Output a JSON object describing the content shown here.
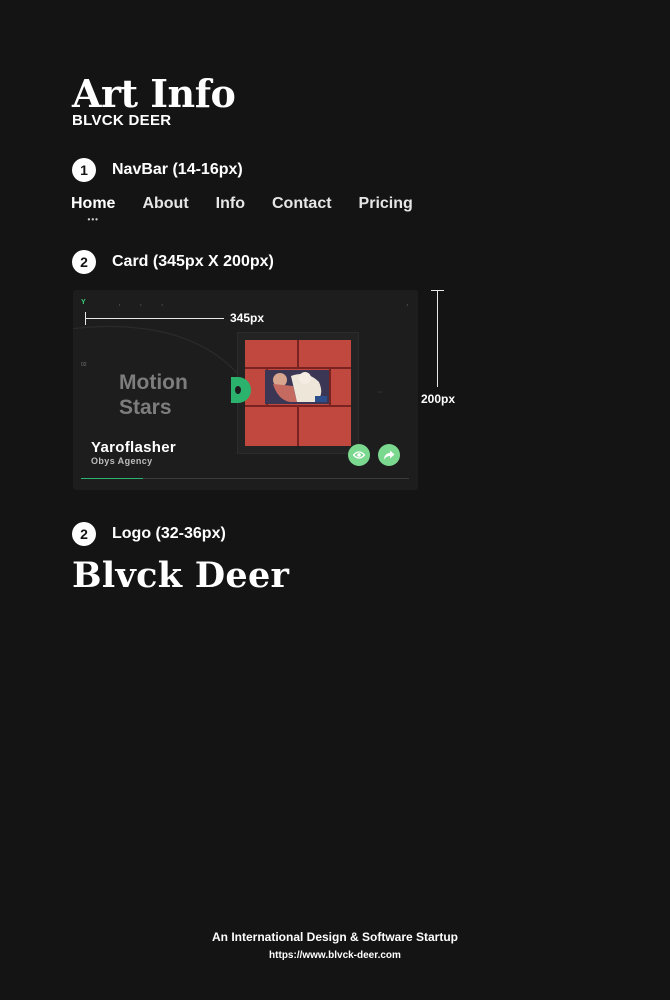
{
  "header": {
    "title": "Art Info",
    "subtitle": "BLVCK DEER"
  },
  "sections": [
    {
      "number": "1",
      "label": "NavBar (14-16px)"
    },
    {
      "number": "2",
      "label": "Card (345px X 200px)"
    },
    {
      "number": "2",
      "label": "Logo (32-36px)"
    }
  ],
  "nav": {
    "items": [
      {
        "label": "Home",
        "active": true
      },
      {
        "label": "About"
      },
      {
        "label": "Info"
      },
      {
        "label": "Contact"
      },
      {
        "label": "Pricing"
      }
    ],
    "active_indicator": "•••"
  },
  "card": {
    "heading": "Motion Stars",
    "name": "Yaroflasher",
    "agency": "Obys Agency",
    "index": "02",
    "width_label": "345px",
    "height_label": "200px",
    "progress": 0.19,
    "icons": {
      "view": "eye-icon",
      "share": "share-arrow-icon"
    },
    "colors": {
      "accent": "#2bb36e",
      "button": "#7bd88f",
      "art": "#c0483f"
    }
  },
  "logo": {
    "text": "Blvck Deer"
  },
  "footer": {
    "tagline": "An International Design & Software Startup",
    "url": "https://www.blvck-deer.com"
  },
  "colors": {
    "background": "#141414",
    "text": "#ffffff"
  }
}
